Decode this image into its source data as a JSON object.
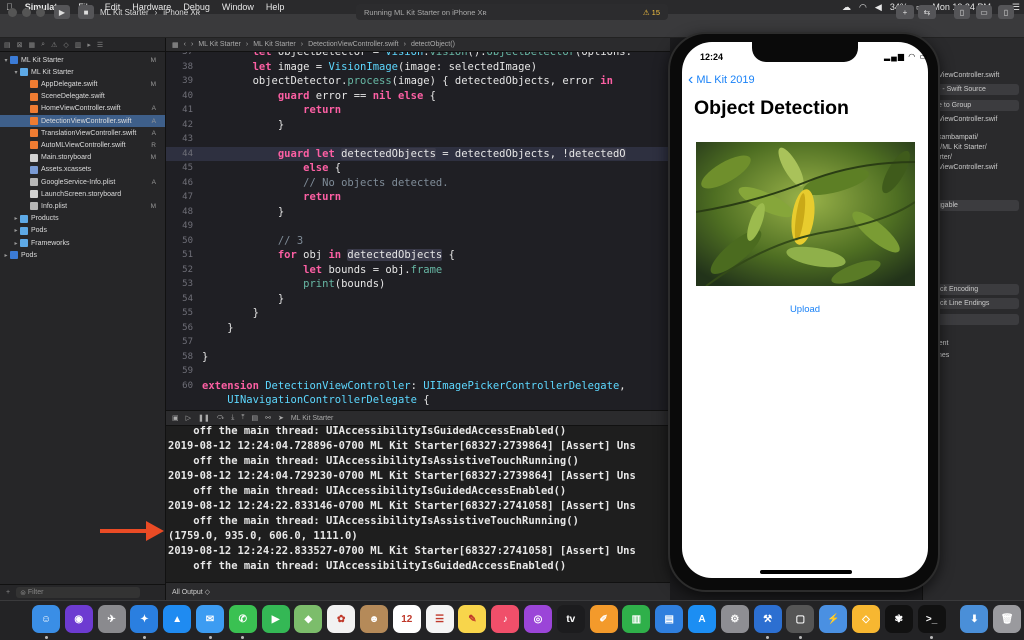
{
  "menubar": {
    "items": [
      "Simulator",
      "File",
      "Edit",
      "Hardware",
      "Debug",
      "Window",
      "Help"
    ],
    "battery": "34%",
    "clock": "Mon 12:24 PM"
  },
  "toolbar": {
    "scheme": "ML Kit Starter",
    "device": "iPhone Xʀ",
    "activity": "Running ML Kit Starter on iPhone Xʀ",
    "warnings": "15"
  },
  "navigator": {
    "items": [
      {
        "label": "ML Kit Starter",
        "badge": "M",
        "indent": 0,
        "icon": "project",
        "tri": "▾"
      },
      {
        "label": "ML Kit Starter",
        "badge": "",
        "indent": 1,
        "icon": "folder",
        "tri": "▾"
      },
      {
        "label": "AppDelegate.swift",
        "badge": "M",
        "indent": 2,
        "icon": "swift",
        "tri": ""
      },
      {
        "label": "SceneDelegate.swift",
        "badge": "",
        "indent": 2,
        "icon": "swift",
        "tri": ""
      },
      {
        "label": "HomeViewController.swift",
        "badge": "A",
        "indent": 2,
        "icon": "swift",
        "tri": ""
      },
      {
        "label": "DetectionViewController.swift",
        "badge": "A",
        "indent": 2,
        "icon": "swift",
        "tri": ""
      },
      {
        "label": "TranslationViewController.swift",
        "badge": "A",
        "indent": 2,
        "icon": "swift",
        "tri": ""
      },
      {
        "label": "AutoMLViewController.swift",
        "badge": "R",
        "indent": 2,
        "icon": "swift",
        "tri": ""
      },
      {
        "label": "Main.storyboard",
        "badge": "M",
        "indent": 2,
        "icon": "board",
        "tri": ""
      },
      {
        "label": "Assets.xcassets",
        "badge": "",
        "indent": 2,
        "icon": "assets",
        "tri": ""
      },
      {
        "label": "GoogleService-Info.plist",
        "badge": "A",
        "indent": 2,
        "icon": "plist",
        "tri": ""
      },
      {
        "label": "LaunchScreen.storyboard",
        "badge": "",
        "indent": 2,
        "icon": "board",
        "tri": ""
      },
      {
        "label": "Info.plist",
        "badge": "M",
        "indent": 2,
        "icon": "plist",
        "tri": ""
      },
      {
        "label": "Products",
        "badge": "",
        "indent": 1,
        "icon": "folder",
        "tri": "▸"
      },
      {
        "label": "Pods",
        "badge": "",
        "indent": 1,
        "icon": "folder",
        "tri": "▸"
      },
      {
        "label": "Frameworks",
        "badge": "",
        "indent": 1,
        "icon": "folder",
        "tri": "▸"
      },
      {
        "label": "Pods",
        "badge": "",
        "indent": 0,
        "icon": "project",
        "tri": "▸"
      }
    ],
    "selected_index": 5,
    "filter_placeholder": "Filter"
  },
  "jumpbar": {
    "crumbs": [
      "ML Kit Starter",
      "ML Kit Starter",
      "DetectionViewController.swift",
      "detectObject()"
    ]
  },
  "code": {
    "lines": [
      {
        "n": "37",
        "html": "        <span class='kw'>let</span> objectDetector = <span class='ty'>Vision</span>.<span class='fn'>vision</span>().<span class='fn'>objectDetector</span>(options:"
      },
      {
        "n": "38",
        "html": "        <span class='kw'>let</span> image = <span class='ty'>VisionImage</span>(image: selectedImage)"
      },
      {
        "n": "39",
        "html": "        objectDetector.<span class='fn'>process</span>(image) { detectedObjects, error <span class='kw'>in</span>"
      },
      {
        "n": "40",
        "html": "            <span class='kw'>guard</span> error == <span class='kw'>nil</span> <span class='kw'>else</span> {"
      },
      {
        "n": "41",
        "html": "                <span class='kw'>return</span>"
      },
      {
        "n": "42",
        "html": "            }"
      },
      {
        "n": "43",
        "html": ""
      },
      {
        "n": "44",
        "html": "            <span class='kw'>guard</span> <span class='kw'>let</span> <span class='sym'>detectedObjects</span> = detectedObjects, !<span class='sym'>detectedO</span>"
      },
      {
        "n": "45",
        "html": "                <span class='kw'>else</span> {"
      },
      {
        "n": "46",
        "html": "                <span class='cm'>// No objects detected.</span>"
      },
      {
        "n": "47",
        "html": "                <span class='kw'>return</span>"
      },
      {
        "n": "48",
        "html": "            }"
      },
      {
        "n": "49",
        "html": ""
      },
      {
        "n": "50",
        "html": "            <span class='cm'>// 3</span>"
      },
      {
        "n": "51",
        "html": "            <span class='kw'>for</span> obj <span class='kw'>in</span> <span class='sym'>detectedObjects</span> {"
      },
      {
        "n": "52",
        "html": "                <span class='kw'>let</span> bounds = obj.<span class='fn'>frame</span>"
      },
      {
        "n": "53",
        "html": "                <span class='fn'>print</span>(bounds)"
      },
      {
        "n": "54",
        "html": "            }"
      },
      {
        "n": "55",
        "html": "        }"
      },
      {
        "n": "56",
        "html": "    }"
      },
      {
        "n": "57",
        "html": ""
      },
      {
        "n": "58",
        "html": "}"
      },
      {
        "n": "59",
        "html": ""
      },
      {
        "n": "60",
        "html": "<span class='kw'>extension</span> <span class='ty'>DetectionViewController</span>: <span class='ty'>UIImagePickerControllerDelegate</span>,"
      },
      {
        "n": "",
        "html": "    <span class='ty'>UINavigationControllerDelegate</span> {"
      }
    ],
    "highlight_line": "44"
  },
  "debugbar": {
    "target": "ML Kit Starter"
  },
  "console": {
    "lines": [
      "    off the main thread: UIAccessibilityIsGuidedAccessEnabled()",
      "2019-08-12 12:24:04.728896-0700 ML Kit Starter[68327:2739864] [Assert] Uns",
      "    off the main thread: UIAccessibilityIsAssistiveTouchRunning()",
      "2019-08-12 12:24:04.729230-0700 ML Kit Starter[68327:2739864] [Assert] Uns",
      "    off the main thread: UIAccessibilityIsGuidedAccessEnabled()",
      "2019-08-12 12:24:22.833146-0700 ML Kit Starter[68327:2741058] [Assert] Uns",
      "    off the main thread: UIAccessibilityIsAssistiveTouchRunning()",
      "(1759.0, 935.0, 606.0, 1111.0)",
      "2019-08-12 12:24:22.833527-0700 ML Kit Starter[68327:2741058] [Assert] Uns",
      "    off the main thread: UIAccessibilityIsGuidedAccessEnabled()"
    ],
    "output_label": "All Output ◇"
  },
  "inspector": {
    "rows": [
      {
        "text": "ionViewController.swift",
        "pill": false
      },
      {
        "text": "ce - Swift Source",
        "pill": true
      },
      {
        "text": "ive to Group",
        "pill": true
      },
      {
        "text": "ionViewController.swif",
        "pill": false
      },
      {
        "text": "saikambampati/",
        "pill": false
      },
      {
        "text": "ads/ML Kit Starter/",
        "pill": false
      },
      {
        "text": "Starter/",
        "pill": false
      },
      {
        "text": "ionViewController.swif",
        "pill": false
      },
      {
        "text": "gs",
        "pill": false
      },
      {
        "text": "aggable",
        "pill": true
      },
      {
        "text": "plicit Encoding",
        "pill": true
      },
      {
        "text": "plicit Line Endings",
        "pill": true
      },
      {
        "text": "s",
        "pill": true
      },
      {
        "text": "4    4",
        "pill": false
      },
      {
        "text": "Indent",
        "pill": false
      },
      {
        "text": "p lines",
        "pill": false
      }
    ]
  },
  "phone": {
    "time": "12:24",
    "back_label": "ML Kit 2019",
    "title": "Object Detection",
    "upload_label": "Upload"
  },
  "dock": {
    "apps": [
      {
        "name": "finder-icon",
        "color": "#3a8ee6",
        "glyph": "☺"
      },
      {
        "name": "siri-icon",
        "color": "#6d3bd1",
        "glyph": "◉"
      },
      {
        "name": "launchpad-icon",
        "color": "#8a8a8e",
        "glyph": "✈"
      },
      {
        "name": "safari-icon",
        "color": "#2a7fe0",
        "glyph": "✦"
      },
      {
        "name": "testflight-icon",
        "color": "#1f8bf1",
        "glyph": "▲"
      },
      {
        "name": "mail-icon",
        "color": "#3c9cf2",
        "glyph": "✉"
      },
      {
        "name": "messages-icon",
        "color": "#3ac152",
        "glyph": "✆"
      },
      {
        "name": "facetime-icon",
        "color": "#34b855",
        "glyph": "▶"
      },
      {
        "name": "maps-icon",
        "color": "#7cbd6b",
        "glyph": "◆"
      },
      {
        "name": "photos-icon",
        "color": "#f2f2f2",
        "glyph": "✿"
      },
      {
        "name": "contacts-icon",
        "color": "#b58a59",
        "glyph": "☻"
      },
      {
        "name": "calendar-icon",
        "color": "#ffffff",
        "glyph": "12"
      },
      {
        "name": "reminders-icon",
        "color": "#f4f4f4",
        "glyph": "☰"
      },
      {
        "name": "notes-icon",
        "color": "#f8d54b",
        "glyph": "✎"
      },
      {
        "name": "music-icon",
        "color": "#f04f6a",
        "glyph": "♪"
      },
      {
        "name": "podcasts-icon",
        "color": "#9b45d8",
        "glyph": "◎"
      },
      {
        "name": "tv-icon",
        "color": "#1c1c1e",
        "glyph": "tv"
      },
      {
        "name": "pages-icon",
        "color": "#f39a2b",
        "glyph": "✐"
      },
      {
        "name": "numbers-icon",
        "color": "#2fb04a",
        "glyph": "▥"
      },
      {
        "name": "keynote-icon",
        "color": "#2f7fde",
        "glyph": "▤"
      },
      {
        "name": "appstore-icon",
        "color": "#1c8ef3",
        "glyph": "A"
      },
      {
        "name": "preferences-icon",
        "color": "#8e8e93",
        "glyph": "⚙"
      },
      {
        "name": "xcode-icon",
        "color": "#2c6fd1",
        "glyph": "⚒"
      },
      {
        "name": "simulator-icon",
        "color": "#555",
        "glyph": "▢"
      },
      {
        "name": "instruments-icon",
        "color": "#4a90e2",
        "glyph": "⚡"
      },
      {
        "name": "sketch-icon",
        "color": "#f7b731",
        "glyph": "◇"
      },
      {
        "name": "butterfly-icon",
        "color": "#111",
        "glyph": "✾"
      },
      {
        "name": "terminal-icon",
        "color": "#111",
        "glyph": ">_"
      },
      {
        "name": "downloads-folder-icon",
        "color": "#4a8fd8",
        "glyph": "⬇"
      },
      {
        "name": "trash-icon",
        "color": "#9a9a9e",
        "glyph": "🗑"
      }
    ]
  }
}
